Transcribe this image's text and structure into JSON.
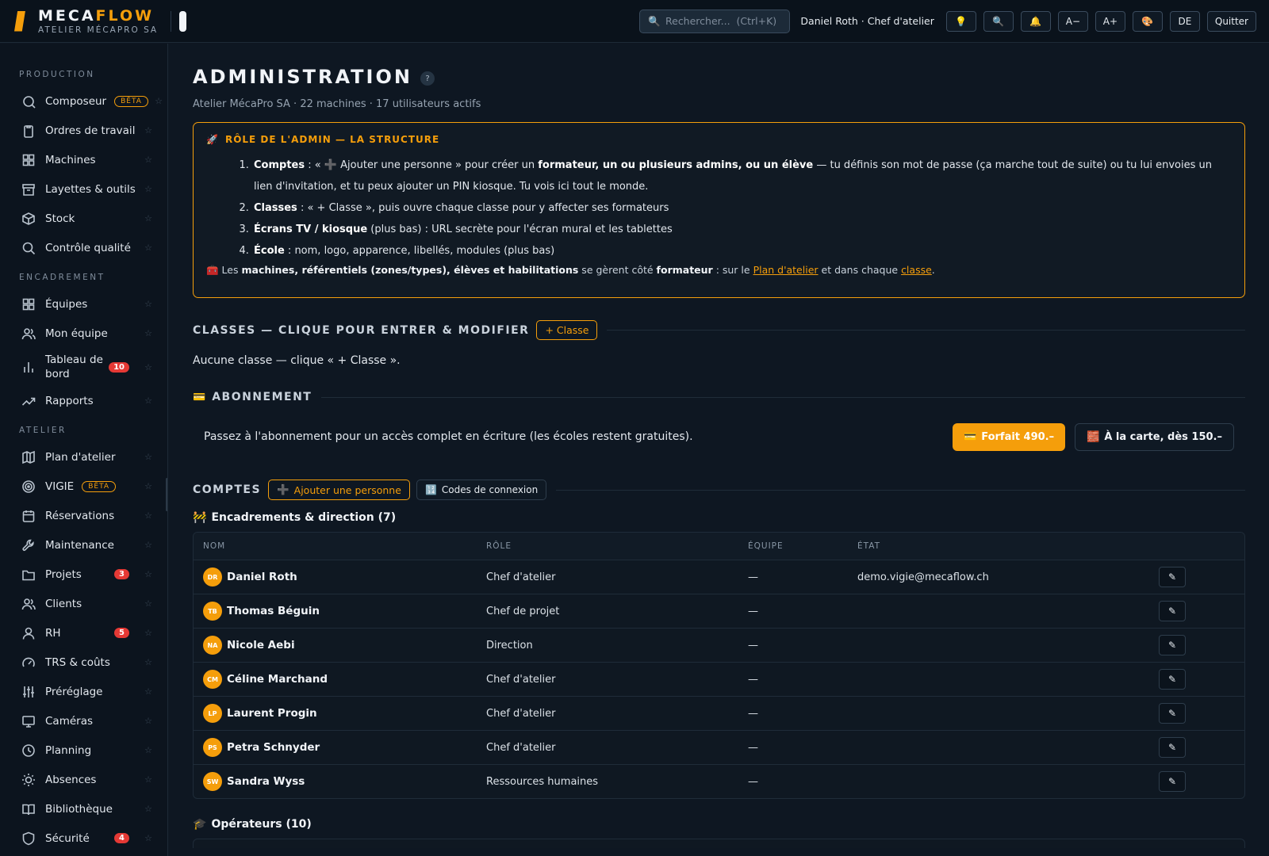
{
  "brand": {
    "name_a": "MECA",
    "name_b": "FLOW",
    "sub": "ATELIER MÉCAPRO SA"
  },
  "topbar": {
    "search_placeholder": "Rechercher...  (Ctrl+K)",
    "user": "Daniel Roth · Chef d'atelier",
    "buttons": [
      {
        "icon": "lightbulb-icon",
        "glyph": "💡"
      },
      {
        "icon": "search-icon",
        "glyph": "🔍"
      },
      {
        "icon": "bell-icon",
        "glyph": "🔔"
      }
    ],
    "font_minus": "A−",
    "font_plus": "A+",
    "theme_glyph": "🎨",
    "lang": "DE",
    "quit": "Quitter"
  },
  "sidebar": {
    "sections": [
      {
        "title": "PRODUCTION",
        "items": [
          {
            "label": "Composeur",
            "icon": "compose-icon",
            "badge": "BÊTA"
          },
          {
            "label": "Ordres de travail",
            "icon": "clipboard-icon"
          },
          {
            "label": "Machines",
            "icon": "grid-icon"
          },
          {
            "label": "Layettes & outils",
            "icon": "archive-icon"
          },
          {
            "label": "Stock",
            "icon": "box-icon"
          },
          {
            "label": "Contrôle qualité",
            "icon": "search-icon"
          }
        ]
      },
      {
        "title": "ENCADREMENT",
        "items": [
          {
            "label": "Équipes",
            "icon": "grid-icon"
          },
          {
            "label": "Mon équipe",
            "icon": "users-icon"
          },
          {
            "label": "Tableau de bord",
            "icon": "bar-chart-icon",
            "count": "10"
          },
          {
            "label": "Rapports",
            "icon": "trend-icon"
          }
        ]
      },
      {
        "title": "ATELIER",
        "items": [
          {
            "label": "Plan d'atelier",
            "icon": "map-icon"
          },
          {
            "label": "VIGIE",
            "icon": "target-icon",
            "badge": "BÊTA"
          },
          {
            "label": "Réservations",
            "icon": "calendar-icon"
          },
          {
            "label": "Maintenance",
            "icon": "wrench-icon"
          },
          {
            "label": "Projets",
            "icon": "folder-icon",
            "count": "3"
          },
          {
            "label": "Clients",
            "icon": "users-icon"
          },
          {
            "label": "RH",
            "icon": "user-icon",
            "count": "5"
          },
          {
            "label": "TRS & coûts",
            "icon": "gauge-icon"
          },
          {
            "label": "Préréglage",
            "icon": "sliders-icon"
          },
          {
            "label": "Caméras",
            "icon": "monitor-icon"
          },
          {
            "label": "Planning",
            "icon": "clock-icon"
          },
          {
            "label": "Absences",
            "icon": "sun-icon"
          },
          {
            "label": "Bibliothèque",
            "icon": "book-icon"
          },
          {
            "label": "Sécurité",
            "icon": "shield-icon",
            "count": "4"
          }
        ]
      }
    ]
  },
  "main": {
    "title": "ADMINISTRATION",
    "help": "?",
    "subtitle": "Atelier MécaPro SA · 22 machines · 17 utilisateurs actifs",
    "info": {
      "title": "RÔLE DE L'ADMIN — LA STRUCTURE",
      "items": [
        {
          "b": "Comptes",
          "a": " : « ➕ Ajouter une personne » pour créer un ",
          "b2": "formateur, un ou plusieurs admins, ou un élève",
          "c": " — tu définis son mot de passe (ça marche tout de suite) ou tu lui envoies un lien d'invitation, et tu peux ajouter un PIN kiosque. Tu vois ici tout le monde."
        },
        {
          "b": "Classes",
          "a": " : « + Classe », puis ouvre chaque classe pour y affecter ses formateurs"
        },
        {
          "b": "Écrans TV / kiosque",
          "a": " (plus bas) : URL secrète pour l'écran mural et les tablettes"
        },
        {
          "b": "École",
          "a": " : nom, logo, apparence, libellés, modules (plus bas)"
        }
      ],
      "note": {
        "a": " Les ",
        "b": "machines, référentiels (zones/types), élèves et habilitations",
        "c": " se gèrent côté ",
        "d": "formateur",
        "e": " : sur le ",
        "link1": "Plan d'atelier",
        "f": " et dans chaque ",
        "link2": "classe",
        "g": "."
      }
    },
    "classes": {
      "title": "CLASSES — CLIQUE POUR ENTRER & MODIFIER",
      "add": "+ Classe",
      "empty": "Aucune classe — clique « + Classe »."
    },
    "subscription": {
      "title": "ABONNEMENT",
      "text": "Passez à l'abonnement pour un accès complet en écriture (les écoles restent gratuites).",
      "forfait": "Forfait 490.–",
      "carte": "À la carte, dès 150.–"
    },
    "accounts": {
      "title": "COMPTES",
      "add": "Ajouter une personne",
      "codes": "Codes de connexion",
      "group1": "Encadrements & direction (7)",
      "group2": "Opérateurs (10)",
      "columns": [
        "NOM",
        "RÔLE",
        "ÉQUIPE",
        "ÉTAT"
      ],
      "rows": [
        {
          "initials": "DR",
          "name": "Daniel Roth",
          "role": "Chef d'atelier",
          "team": "—",
          "state": "demo.vigie@mecaflow.ch"
        },
        {
          "initials": "TB",
          "name": "Thomas Béguin",
          "role": "Chef de projet",
          "team": "—",
          "state": ""
        },
        {
          "initials": "NA",
          "name": "Nicole Aebi",
          "role": "Direction",
          "team": "—",
          "state": ""
        },
        {
          "initials": "CM",
          "name": "Céline Marchand",
          "role": "Chef d'atelier",
          "team": "—",
          "state": ""
        },
        {
          "initials": "LP",
          "name": "Laurent Progin",
          "role": "Chef d'atelier",
          "team": "—",
          "state": ""
        },
        {
          "initials": "PS",
          "name": "Petra Schnyder",
          "role": "Chef d'atelier",
          "team": "—",
          "state": ""
        },
        {
          "initials": "SW",
          "name": "Sandra Wyss",
          "role": "Ressources humaines",
          "team": "—",
          "state": ""
        }
      ]
    }
  },
  "colors": {
    "accent": "#f59e0b",
    "bg": "#0e1722",
    "badge": "#e53935"
  }
}
